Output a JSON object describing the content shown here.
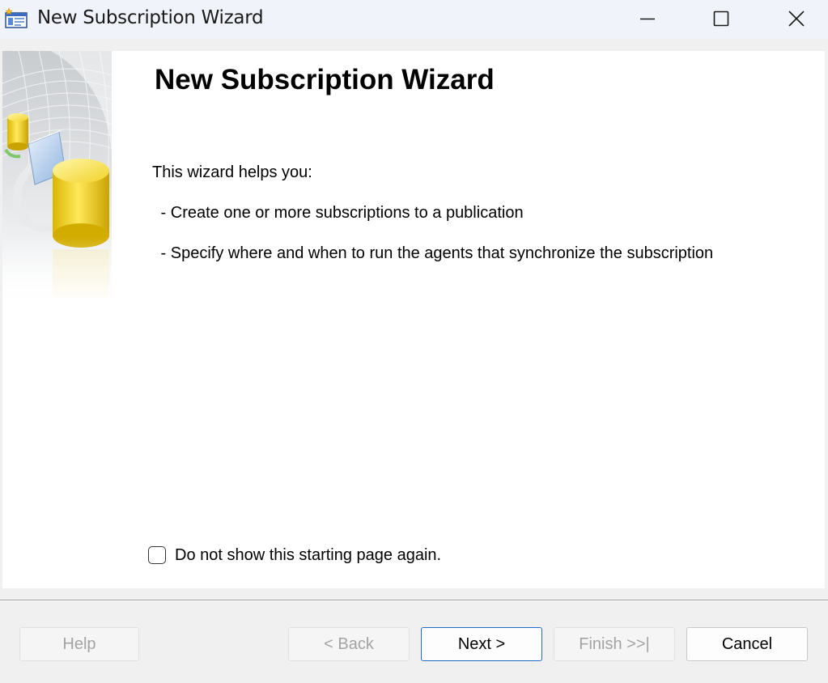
{
  "window": {
    "title": "New Subscription Wizard"
  },
  "page": {
    "heading": "New Subscription Wizard",
    "intro": "This wizard helps you:",
    "bullets": [
      " - Create one or more subscriptions to a publication",
      " - Specify where and when to run the agents that synchronize the subscription"
    ],
    "dont_show_label": "Do not show this starting page again.",
    "dont_show_checked": false
  },
  "buttons": {
    "help": "Help",
    "back": "< Back",
    "next": "Next >",
    "finish": "Finish >>|",
    "cancel": "Cancel"
  },
  "icons": {
    "app": "wizard-window-icon",
    "minimize": "minimize-icon",
    "maximize": "maximize-icon",
    "close": "close-icon",
    "side": "database-wizard-art"
  },
  "colors": {
    "accent": "#1f6fc5",
    "titlebar": "#f0f3f9",
    "disabled_text": "#a3a3a3"
  }
}
